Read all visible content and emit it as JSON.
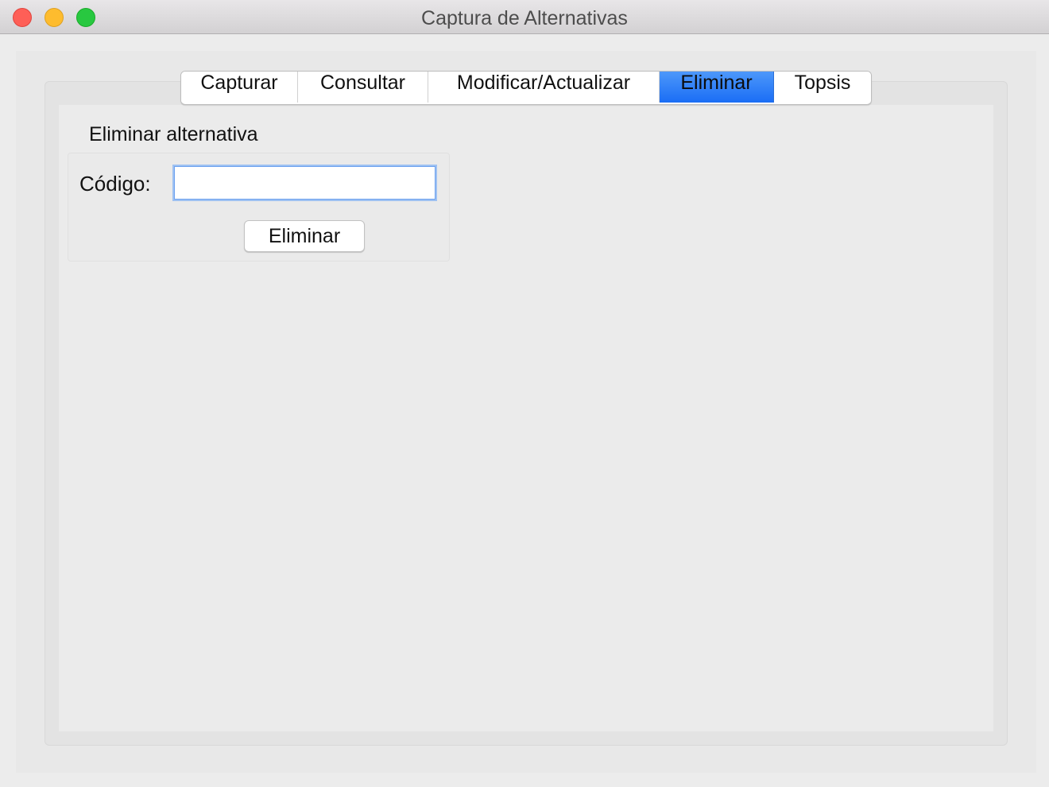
{
  "window": {
    "title": "Captura de Alternativas",
    "controls": [
      "close",
      "minimize",
      "zoom"
    ]
  },
  "tabs": [
    {
      "label": "Capturar",
      "active": false
    },
    {
      "label": "Consultar",
      "active": false
    },
    {
      "label": "Modificar/Actualizar",
      "active": false
    },
    {
      "label": "Eliminar",
      "active": true
    },
    {
      "label": "Topsis",
      "active": false
    }
  ],
  "panel": {
    "section_title": "Eliminar alternativa",
    "code_label": "Código:",
    "code_value": "",
    "delete_button": "Eliminar"
  },
  "colors": {
    "active_tab": "#1a6df5",
    "close": "#fe5f57",
    "minimize": "#febc2e",
    "zoom": "#28c840"
  }
}
